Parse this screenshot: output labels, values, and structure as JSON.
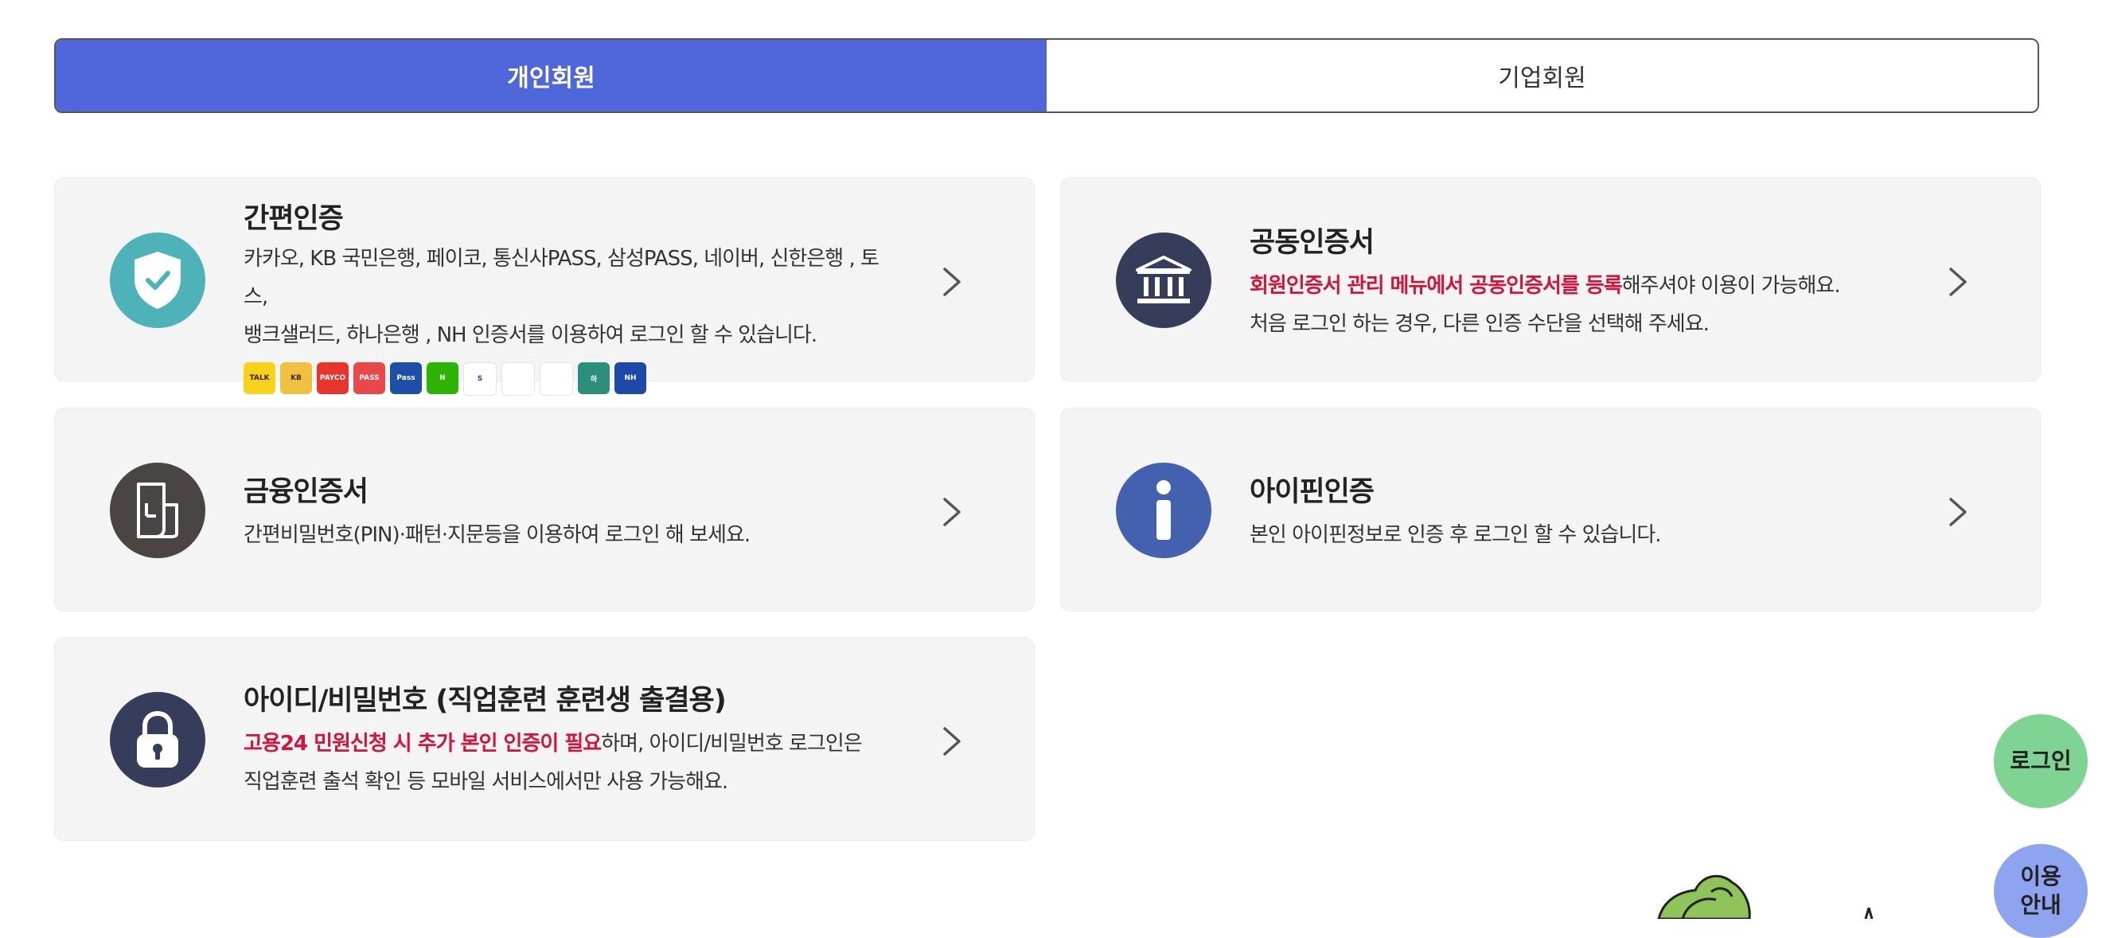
{
  "tabs": {
    "personal": "개인회원",
    "business": "기업회원"
  },
  "cards": {
    "simple": {
      "title": "간편인증",
      "desc_line1": "카카오, KB 국민은행, 페이코, 통신사PASS, 삼성PASS, 네이버, 신한은행 , 토스,",
      "desc_line2": "뱅크샐러드, 하나은행 , NH 인증서를 이용하여 로그인 할 수 있습니다.",
      "logos": [
        {
          "name": "kakao-logo",
          "text": "TALK",
          "bg": "#f7d21a",
          "fg": "#3a1d1d"
        },
        {
          "name": "kb-logo",
          "text": "KB",
          "bg": "#f0c040",
          "fg": "#3a2f1e"
        },
        {
          "name": "payco-logo",
          "text": "PAYCO",
          "bg": "#e8352b",
          "fg": "#ffffff"
        },
        {
          "name": "pass-logo",
          "text": "PASS",
          "bg": "#e94848",
          "fg": "#ffffff"
        },
        {
          "name": "samsung-pass-logo",
          "text": "Pass",
          "bg": "#1e4fa8",
          "fg": "#ffffff"
        },
        {
          "name": "naver-logo",
          "text": "N",
          "bg": "#2db400",
          "fg": "#ffffff"
        },
        {
          "name": "shinhan-logo",
          "text": "S",
          "bg": "#ffffff",
          "fg": "#1c4aa8"
        },
        {
          "name": "toss-logo",
          "text": "",
          "bg": "#ffffff",
          "fg": "#2a6ef0"
        },
        {
          "name": "banksalad-logo",
          "text": "",
          "bg": "#ffffff",
          "fg": "#27b46b"
        },
        {
          "name": "hana-logo",
          "text": "하",
          "bg": "#2c8f7b",
          "fg": "#ffffff"
        },
        {
          "name": "nh-logo",
          "text": "NH",
          "bg": "#1d49a8",
          "fg": "#ffffff"
        }
      ]
    },
    "joint": {
      "title": "공동인증서",
      "desc_red": "회원인증서 관리 메뉴에서 공동인증서를 등록",
      "desc_rest": "해주셔야 이용이 가능해요.",
      "desc_line2": "처음 로그인 하는 경우, 다른 인증 수단을 선택해 주세요."
    },
    "finance": {
      "title": "금융인증서",
      "desc": "간편비밀번호(PIN)·패턴·지문등을 이용하여 로그인 해 보세요."
    },
    "ipin": {
      "title": "아이핀인증",
      "desc": "본인 아이핀정보로 인증 후 로그인 할 수 있습니다."
    },
    "idpw": {
      "title": "아이디/비밀번호 (직업훈련 훈련생 출결용)",
      "desc_red": "고용24 민원신청 시 추가 본인 인증이 필요",
      "desc_rest": "하며, 아이디/비밀번호 로그인은",
      "desc_line2": "직업훈련 출석 확인 등 모바일 서비스에서만 사용 가능해요."
    }
  },
  "fabs": {
    "login": "로그인",
    "guide_line1": "이용",
    "guide_line2": "안내"
  },
  "colors": {
    "accent": "#5066db",
    "alert_red": "#d0143a",
    "simple_icon_bg": "#4db3b9",
    "joint_icon_bg": "#353d5a",
    "finance_icon_bg": "#4a4442",
    "ipin_icon_bg": "#4461b0",
    "idpw_icon_bg": "#353d5a",
    "login_fab": "#7fd494",
    "guide_fab": "#8ea4f0"
  },
  "icons": [
    "shield-check-icon",
    "bank-building-icon",
    "document-phone-icon",
    "info-icon",
    "lock-icon",
    "chevron-right-icon"
  ]
}
